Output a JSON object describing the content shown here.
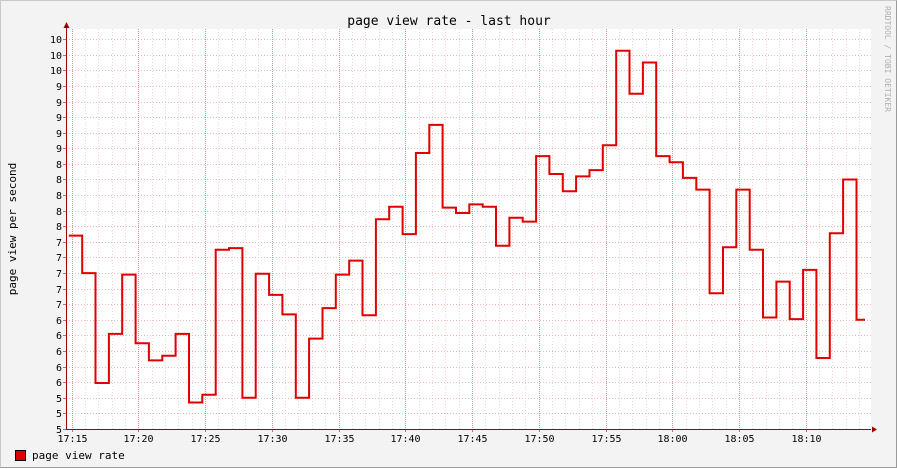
{
  "chart_data": {
    "type": "line",
    "title": "page view rate - last hour",
    "ylabel": "page view per second",
    "xlabel": "",
    "watermark": "RRDTOOL / TOBI OETIKER",
    "ylim": [
      5,
      10.13
    ],
    "y_ticks": [
      {
        "value": 5.0,
        "label": "5"
      },
      {
        "value": 5.2,
        "label": "5"
      },
      {
        "value": 5.4,
        "label": "5"
      },
      {
        "value": 5.6,
        "label": "6"
      },
      {
        "value": 5.8,
        "label": "6"
      },
      {
        "value": 6.0,
        "label": "6"
      },
      {
        "value": 6.2,
        "label": "6"
      },
      {
        "value": 6.4,
        "label": "6"
      },
      {
        "value": 6.6,
        "label": "7"
      },
      {
        "value": 6.8,
        "label": "7"
      },
      {
        "value": 7.0,
        "label": "7"
      },
      {
        "value": 7.2,
        "label": "7"
      },
      {
        "value": 7.4,
        "label": "7"
      },
      {
        "value": 7.6,
        "label": "8"
      },
      {
        "value": 7.8,
        "label": "8"
      },
      {
        "value": 8.0,
        "label": "8"
      },
      {
        "value": 8.2,
        "label": "8"
      },
      {
        "value": 8.4,
        "label": "8"
      },
      {
        "value": 8.6,
        "label": "9"
      },
      {
        "value": 8.8,
        "label": "9"
      },
      {
        "value": 9.0,
        "label": "9"
      },
      {
        "value": 9.2,
        "label": "9"
      },
      {
        "value": 9.4,
        "label": "9"
      },
      {
        "value": 9.6,
        "label": "10"
      },
      {
        "value": 9.8,
        "label": "10"
      },
      {
        "value": 10.0,
        "label": "10"
      }
    ],
    "x_range_minutes": [
      0,
      60
    ],
    "x_ticks": [
      {
        "minute": 0,
        "label": "17:15"
      },
      {
        "minute": 5,
        "label": "17:20"
      },
      {
        "minute": 10,
        "label": "17:25"
      },
      {
        "minute": 15,
        "label": "17:30"
      },
      {
        "minute": 20,
        "label": "17:35"
      },
      {
        "minute": 25,
        "label": "17:40"
      },
      {
        "minute": 30,
        "label": "17:45"
      },
      {
        "minute": 35,
        "label": "17:50"
      },
      {
        "minute": 40,
        "label": "17:55"
      },
      {
        "minute": 45,
        "label": "18:00"
      },
      {
        "minute": 50,
        "label": "18:05"
      },
      {
        "minute": 55,
        "label": "18:10"
      }
    ],
    "grid": true,
    "legend_position": "bottom-left",
    "series": [
      {
        "name": "page view rate",
        "color": "#e00000",
        "step_start_minute": -0.2,
        "step_minutes": 0.5,
        "values": [
          7.48,
          7.48,
          7.0,
          7.0,
          5.59,
          5.59,
          6.22,
          6.22,
          6.98,
          6.98,
          6.1,
          6.1,
          5.88,
          5.88,
          5.94,
          5.94,
          6.22,
          6.22,
          5.34,
          5.34,
          5.44,
          5.44,
          7.3,
          7.3,
          7.32,
          7.32,
          5.4,
          5.4,
          6.99,
          6.99,
          6.72,
          6.72,
          6.47,
          6.47,
          5.4,
          5.4,
          6.16,
          6.16,
          6.55,
          6.55,
          6.98,
          6.98,
          7.16,
          7.16,
          6.46,
          6.46,
          7.69,
          7.69,
          7.85,
          7.85,
          7.5,
          7.5,
          8.54,
          8.54,
          8.9,
          8.9,
          7.84,
          7.84,
          7.77,
          7.77,
          7.88,
          7.88,
          7.85,
          7.85,
          7.35,
          7.35,
          7.71,
          7.71,
          7.66,
          7.66,
          8.5,
          8.5,
          8.27,
          8.27,
          8.05,
          8.05,
          8.24,
          8.24,
          8.32,
          8.32,
          8.64,
          8.64,
          9.85,
          9.85,
          9.3,
          9.3,
          9.7,
          9.7,
          8.5,
          8.5,
          8.42,
          8.42,
          8.22,
          8.22,
          8.07,
          8.07,
          6.74,
          6.74,
          7.33,
          7.33,
          8.07,
          8.07,
          7.3,
          7.3,
          6.43,
          6.43,
          6.89,
          6.89,
          6.41,
          6.41,
          7.04,
          7.04,
          5.91,
          5.91,
          7.51,
          7.51,
          8.2,
          8.2,
          6.4,
          6.4
        ]
      }
    ]
  }
}
